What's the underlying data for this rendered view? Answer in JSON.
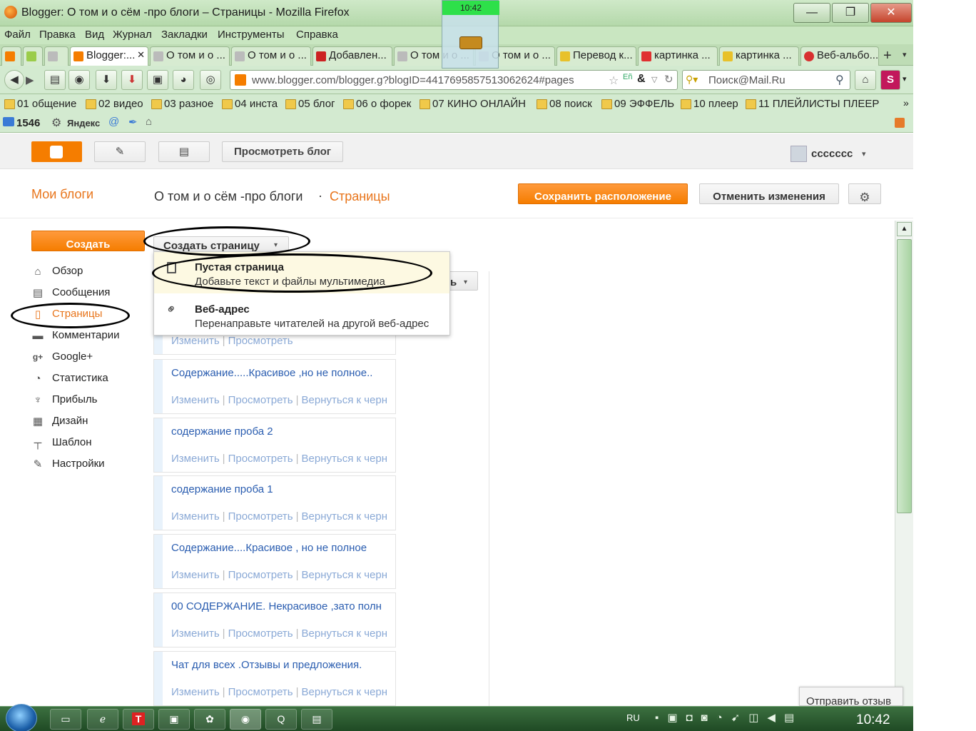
{
  "window": {
    "title": "Blogger: О том и о сём -про блоги – Страницы - Mozilla Firefox",
    "clock_badge": "10:42",
    "min": "—",
    "max": "❐",
    "close": "✕"
  },
  "menu": [
    "Файл",
    "Правка",
    "Вид",
    "Журнал",
    "Закладки",
    "Инструменты",
    "Справка"
  ],
  "tabs": [
    {
      "label": "",
      "color": "#f57d00"
    },
    {
      "label": "",
      "color": "#9bcc4a"
    },
    {
      "label": "",
      "color": "#bbbbbb"
    },
    {
      "label": "Blogger:...",
      "color": "#f57d00",
      "active": true
    },
    {
      "label": "О том и о ...",
      "color": "#bbbbbb"
    },
    {
      "label": "О том и о ...",
      "color": "#bbbbbb"
    },
    {
      "label": "Добавлен...",
      "color": "#cc2222"
    },
    {
      "label": "О том и о ...",
      "color": "#bbbbbb"
    },
    {
      "label": "О том и о ...",
      "color": "#bbbbbb"
    },
    {
      "label": "Перевод к...",
      "color": "#e8c12a"
    },
    {
      "label": "картинка ...",
      "color": "#e03030"
    },
    {
      "label": "картинка ...",
      "color": "#e8c12a"
    },
    {
      "label": "Веб-альбо...",
      "color": "#d83030"
    }
  ],
  "nav": {
    "url": "www.blogger.com/blogger.g?blogID=4417695857513062624#pages",
    "search": "Поиск@Mail.Ru"
  },
  "bookmarks": [
    "01 общение",
    "02 видео",
    "03 разное",
    "04 инста",
    "05 блог",
    "06 о форек",
    "07 КИНО ОНЛАЙН",
    "08 поиск",
    "09 ЭФФЕЛЬ",
    "10 плеер",
    "11 ПЛЕЙЛИСТЫ ПЛЕЕР"
  ],
  "toolbar2": {
    "mail_count": "1546",
    "yandex": "Яндекс"
  },
  "blogger": {
    "view_blog": "Просмотреть блог",
    "user": "ccccccc",
    "my_blogs": "Мои блоги",
    "blog_title": "О том и о сём -про блоги",
    "dot": "·",
    "section": "Страницы",
    "save_layout": "Сохранить расположение",
    "cancel_changes": "Отменить изменения",
    "create": "Создать",
    "create_page": "Создать страницу",
    "hidden_button_tail": "ь"
  },
  "sidebar": [
    {
      "label": "Обзор",
      "icon": "⌂",
      "name": "home-icon"
    },
    {
      "label": "Сообщения",
      "icon": "▤",
      "name": "posts-icon"
    },
    {
      "label": "Страницы",
      "icon": "▯",
      "name": "pages-icon",
      "active": true
    },
    {
      "label": "Комментарии",
      "icon": "▬",
      "name": "comments-icon"
    },
    {
      "label": "Google+",
      "icon": "g+",
      "name": "google-plus-icon"
    },
    {
      "label": "Статистика",
      "icon": "◔",
      "name": "stats-icon"
    },
    {
      "label": "Прибыль",
      "icon": "♆",
      "name": "earnings-icon"
    },
    {
      "label": "Дизайн",
      "icon": "▦",
      "name": "layout-icon"
    },
    {
      "label": "Шаблон",
      "icon": "┬",
      "name": "template-icon"
    },
    {
      "label": "Настройки",
      "icon": "✎",
      "name": "settings-icon"
    }
  ],
  "dropdown": [
    {
      "title": "Пустая страница",
      "desc": "Добавьте текст и файлы мультимедиа"
    },
    {
      "title": "Веб-адрес",
      "desc": "Перенаправьте читателей на другой веб-адрес"
    }
  ],
  "actions": {
    "edit": "Изменить",
    "view": "Просмотреть",
    "revert": "Вернуться к черн",
    "sep": "|"
  },
  "pages": [
    "Содержание.....Красивое ,но не полное..",
    "содержание проба 2",
    "содержание проба 1",
    "Содержание....Красивое , но не полное",
    "00 СОДЕРЖАНИЕ. Некрасивое ,зато полн",
    "Чат для всех .Отзывы и предложения."
  ],
  "feedback": "Отправить отзыв",
  "tray": {
    "lang": "RU",
    "time": "10:42"
  },
  "colors": {
    "orange": "#f57d00",
    "link": "#2a5db0",
    "link_muted": "#8aa9d6",
    "chrome_green": "#c9e6c1"
  }
}
